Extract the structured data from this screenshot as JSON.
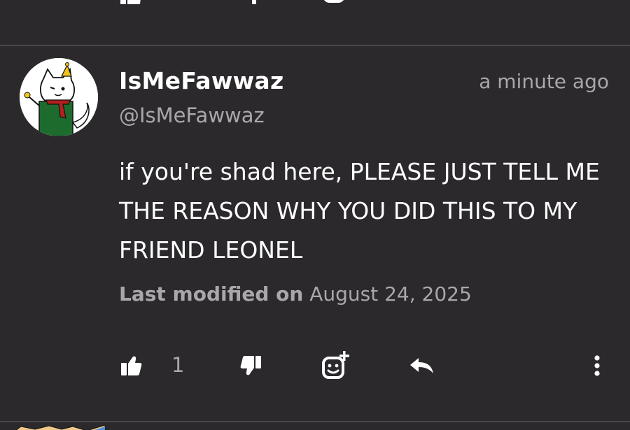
{
  "comment": {
    "username": "IsMeFawwaz",
    "handle": "@IsMeFawwaz",
    "timestamp": "a minute ago",
    "body": "if you're shad here, PLEASE JUST TELL ME THE REASON WHY YOU DID THIS TO MY FRIEND LEONEL",
    "modified_label": "Last modified on",
    "modified_date": "August 24, 2025",
    "like_count": "1"
  },
  "icons": {
    "like": "thumbs-up-icon",
    "dislike": "thumbs-down-icon",
    "react": "add-reaction-icon",
    "reply": "reply-icon",
    "more": "more-vertical-icon"
  },
  "colors": {
    "background": "#2b292c",
    "primary_text": "#ffffff",
    "secondary_text": "#a9a7ab",
    "divider": "#4a474c",
    "avatar_green": "#1e6b2e",
    "avatar_scarf": "#b3201e",
    "avatar_hat": "#f0c419"
  }
}
